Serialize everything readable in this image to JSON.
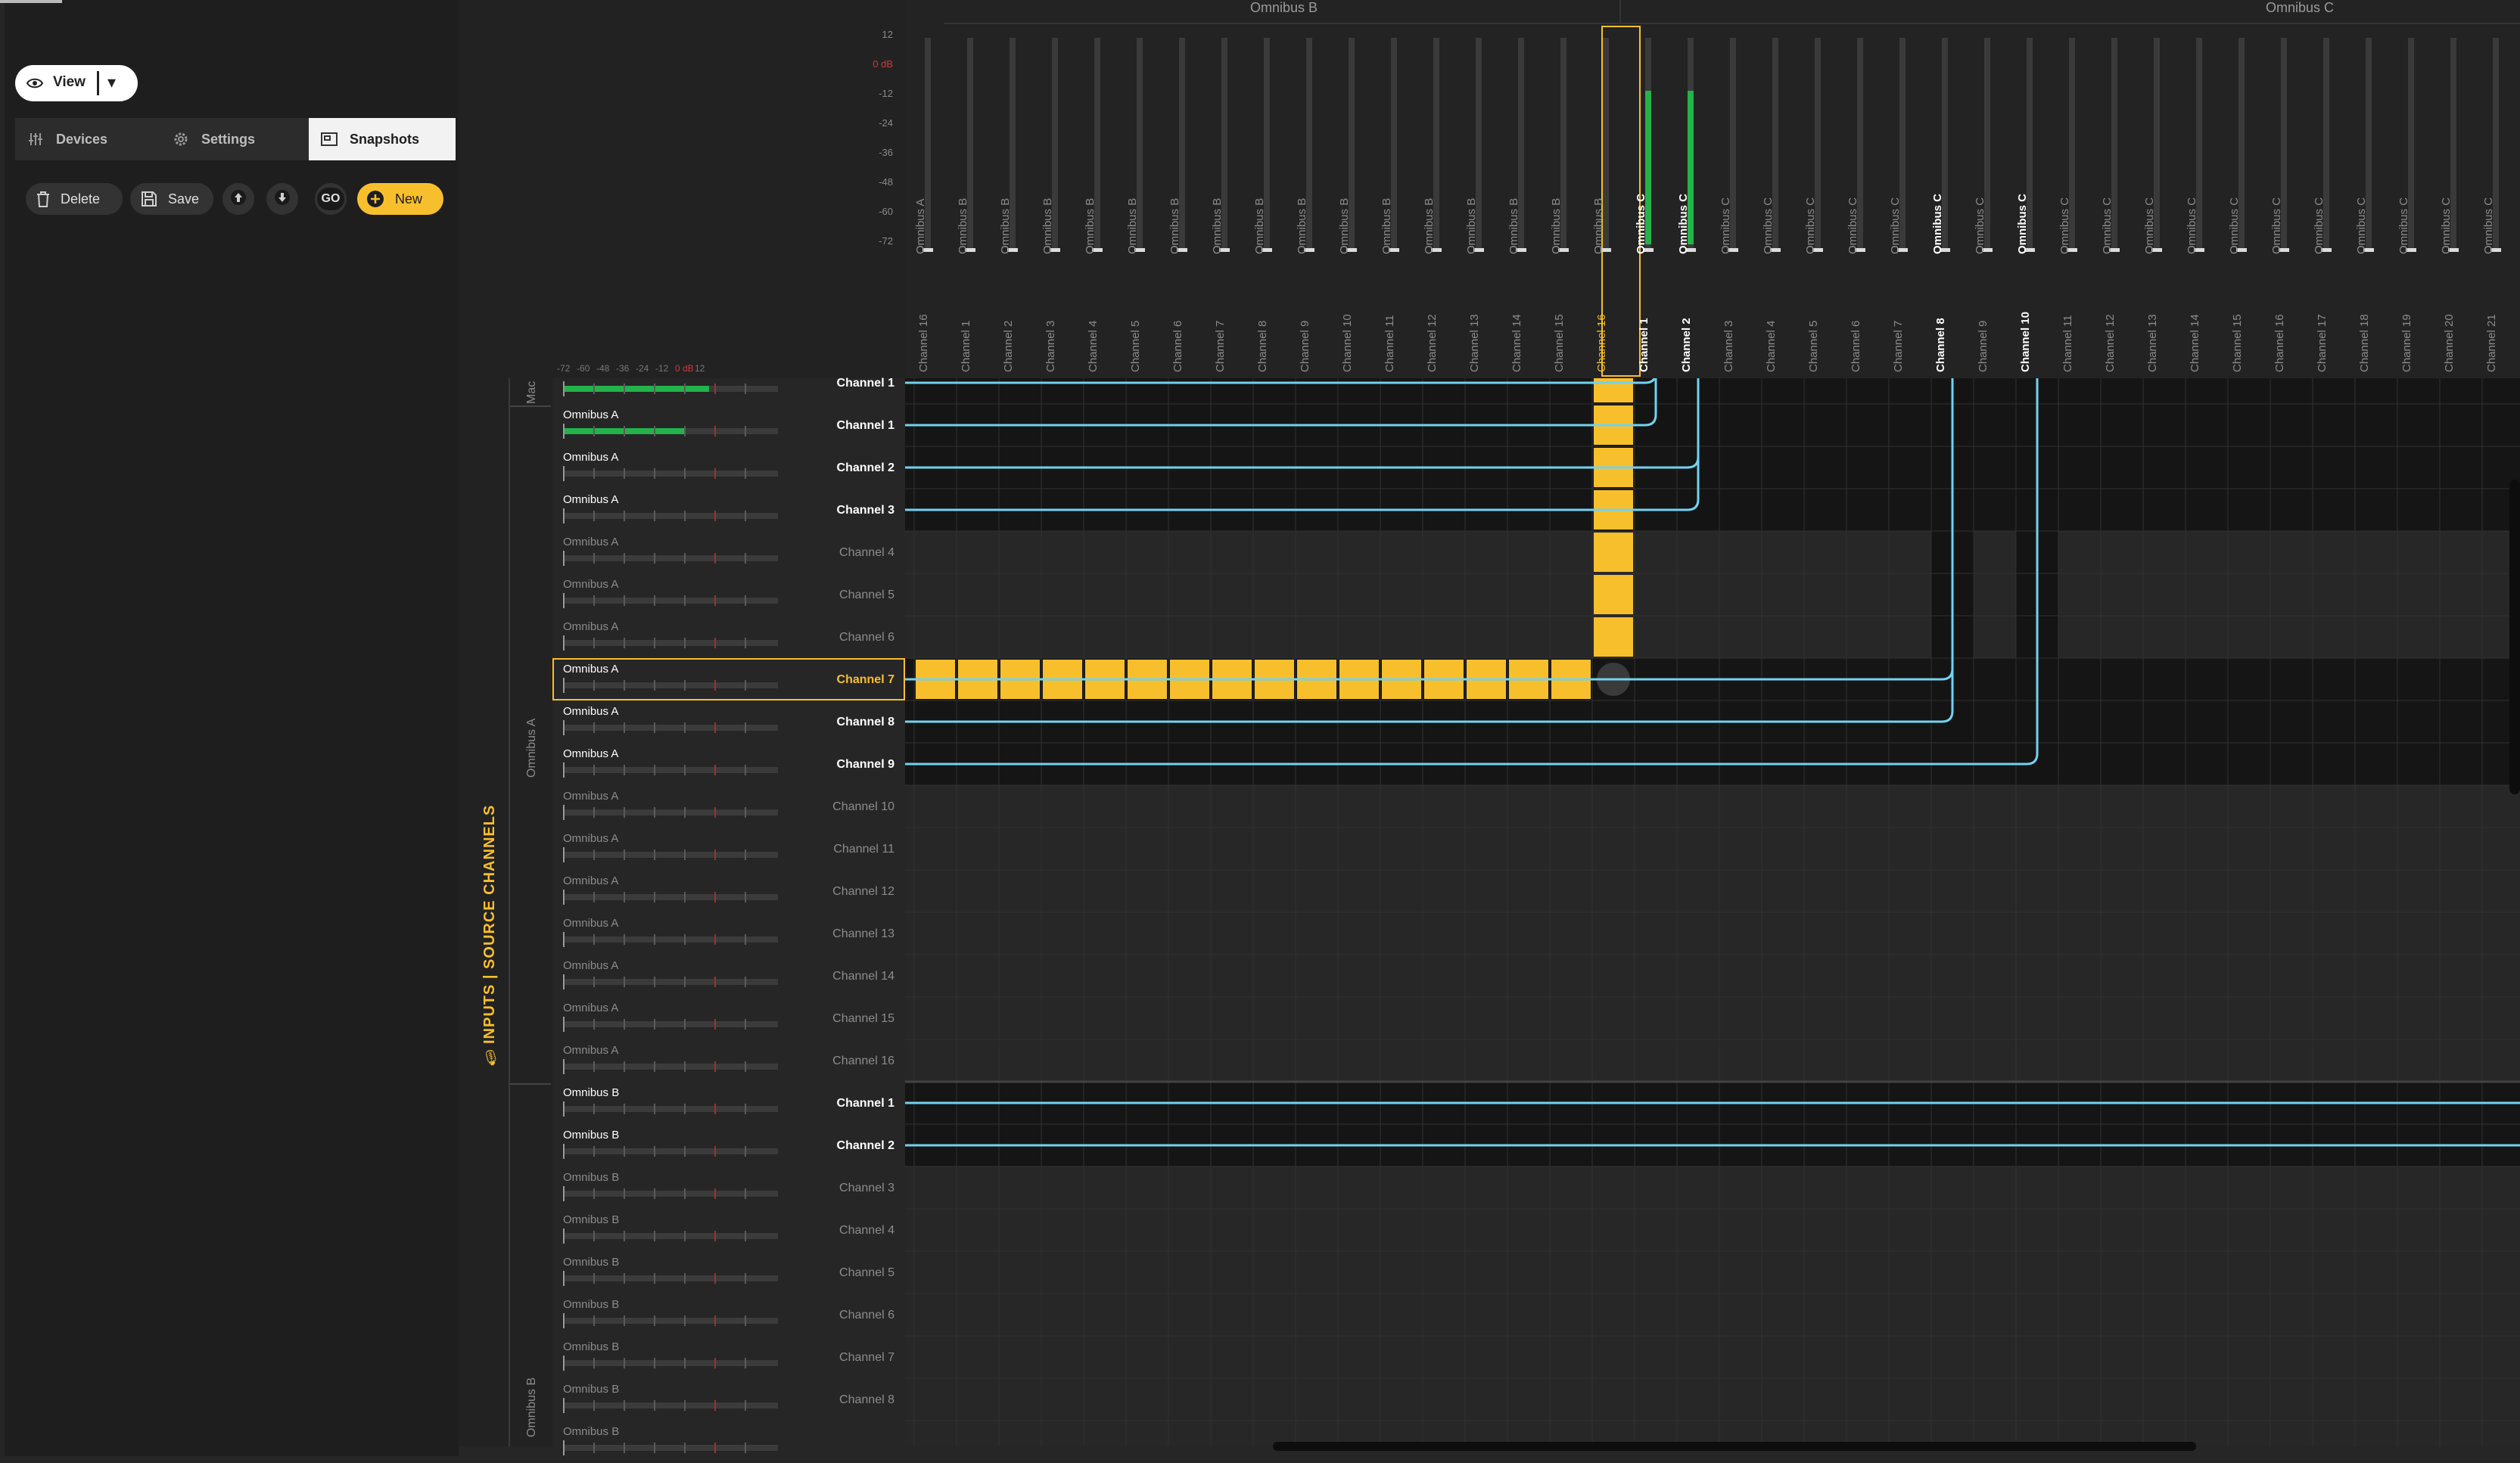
{
  "toolbar": {
    "view_label": "View"
  },
  "tabs": [
    {
      "label": "Devices",
      "icon": "sliders-icon"
    },
    {
      "label": "Settings",
      "icon": "gear-icon"
    },
    {
      "label": "Snapshots",
      "icon": "snapshot-icon",
      "active": true
    }
  ],
  "snapshots": {
    "delete_label": "Delete",
    "save_label": "Save",
    "go_label": "GO",
    "new_label": "New"
  },
  "outputs": {
    "bus_b_title": "Omnibus B",
    "bus_c_title": "Omnibus C",
    "scale_labels": [
      "12",
      "0 dB",
      "-12",
      "-24",
      "-36",
      "-48",
      "-60",
      "-72"
    ],
    "columns": [
      {
        "bus": "Omnibus A",
        "channel": "Channel 16"
      },
      {
        "bus": "Omnibus B",
        "channel": "Channel 1"
      },
      {
        "bus": "Omnibus B",
        "channel": "Channel 2"
      },
      {
        "bus": "Omnibus B",
        "channel": "Channel 3"
      },
      {
        "bus": "Omnibus B",
        "channel": "Channel 4"
      },
      {
        "bus": "Omnibus B",
        "channel": "Channel 5"
      },
      {
        "bus": "Omnibus B",
        "channel": "Channel 6"
      },
      {
        "bus": "Omnibus B",
        "channel": "Channel 7"
      },
      {
        "bus": "Omnibus B",
        "channel": "Channel 8"
      },
      {
        "bus": "Omnibus B",
        "channel": "Channel 9"
      },
      {
        "bus": "Omnibus B",
        "channel": "Channel 10"
      },
      {
        "bus": "Omnibus B",
        "channel": "Channel 11"
      },
      {
        "bus": "Omnibus B",
        "channel": "Channel 12"
      },
      {
        "bus": "Omnibus B",
        "channel": "Channel 13"
      },
      {
        "bus": "Omnibus B",
        "channel": "Channel 14"
      },
      {
        "bus": "Omnibus B",
        "channel": "Channel 15"
      },
      {
        "bus": "Omnibus B",
        "channel": "Channel 16",
        "selected": true
      },
      {
        "bus": "Omnibus C",
        "channel": "Channel 1",
        "bright": true,
        "level": 0.72
      },
      {
        "bus": "Omnibus C",
        "channel": "Channel 2",
        "bright": true,
        "level": 0.72
      },
      {
        "bus": "Omnibus C",
        "channel": "Channel 3"
      },
      {
        "bus": "Omnibus C",
        "channel": "Channel 4"
      },
      {
        "bus": "Omnibus C",
        "channel": "Channel 5"
      },
      {
        "bus": "Omnibus C",
        "channel": "Channel 6"
      },
      {
        "bus": "Omnibus C",
        "channel": "Channel 7"
      },
      {
        "bus": "Omnibus C",
        "channel": "Channel 8",
        "bright": true
      },
      {
        "bus": "Omnibus C",
        "channel": "Channel 9"
      },
      {
        "bus": "Omnibus C",
        "channel": "Channel 10",
        "bright": true
      },
      {
        "bus": "Omnibus C",
        "channel": "Channel 11"
      },
      {
        "bus": "Omnibus C",
        "channel": "Channel 12"
      },
      {
        "bus": "Omnibus C",
        "channel": "Channel 13"
      },
      {
        "bus": "Omnibus C",
        "channel": "Channel 14"
      },
      {
        "bus": "Omnibus C",
        "channel": "Channel 15"
      },
      {
        "bus": "Omnibus C",
        "channel": "Channel 16"
      },
      {
        "bus": "Omnibus C",
        "channel": "Channel 17"
      },
      {
        "bus": "Omnibus C",
        "channel": "Channel 18"
      },
      {
        "bus": "Omnibus C",
        "channel": "Channel 19"
      },
      {
        "bus": "Omnibus C",
        "channel": "Channel 20"
      },
      {
        "bus": "Omnibus C",
        "channel": "Channel 21"
      }
    ]
  },
  "inputs": {
    "title": "INPUTS | SOURCE CHANNELS",
    "scale_labels": [
      "-72",
      "-60",
      "-48",
      "-36",
      "-24",
      "-12",
      "0 dB",
      "12"
    ],
    "groups": [
      "Mac",
      "Omnibus A",
      "Omnibus B"
    ],
    "rows": [
      {
        "bus": "",
        "channel": "Channel 1",
        "bright": true,
        "level": 0.68
      },
      {
        "bus": "Omnibus A",
        "channel": "Channel 1",
        "bright": true,
        "level": 0.57
      },
      {
        "bus": "Omnibus A",
        "channel": "Channel 2",
        "bright": true
      },
      {
        "bus": "Omnibus A",
        "channel": "Channel 3",
        "bright": true
      },
      {
        "bus": "Omnibus A",
        "channel": "Channel 4"
      },
      {
        "bus": "Omnibus A",
        "channel": "Channel 5"
      },
      {
        "bus": "Omnibus A",
        "channel": "Channel 6"
      },
      {
        "bus": "Omnibus A",
        "channel": "Channel 7",
        "bright": true,
        "selected": true
      },
      {
        "bus": "Omnibus A",
        "channel": "Channel 8",
        "bright": true
      },
      {
        "bus": "Omnibus A",
        "channel": "Channel 9",
        "bright": true
      },
      {
        "bus": "Omnibus A",
        "channel": "Channel 10"
      },
      {
        "bus": "Omnibus A",
        "channel": "Channel 11"
      },
      {
        "bus": "Omnibus A",
        "channel": "Channel 12"
      },
      {
        "bus": "Omnibus A",
        "channel": "Channel 13"
      },
      {
        "bus": "Omnibus A",
        "channel": "Channel 14"
      },
      {
        "bus": "Omnibus A",
        "channel": "Channel 15"
      },
      {
        "bus": "Omnibus A",
        "channel": "Channel 16"
      },
      {
        "bus": "Omnibus B",
        "channel": "Channel 1",
        "bright": true
      },
      {
        "bus": "Omnibus B",
        "channel": "Channel 2",
        "bright": true
      },
      {
        "bus": "Omnibus B",
        "channel": "Channel 3"
      },
      {
        "bus": "Omnibus B",
        "channel": "Channel 4"
      },
      {
        "bus": "Omnibus B",
        "channel": "Channel 5"
      },
      {
        "bus": "Omnibus B",
        "channel": "Channel 6"
      },
      {
        "bus": "Omnibus B",
        "channel": "Channel 7"
      },
      {
        "bus": "Omnibus B",
        "channel": "Channel 8"
      },
      {
        "bus": "Omnibus B",
        "channel": ""
      }
    ]
  },
  "routes": [
    {
      "row": 0,
      "col": 17
    },
    {
      "row": 1,
      "col": 17
    },
    {
      "row": 2,
      "col": 18
    },
    {
      "row": 3,
      "col": 18
    },
    {
      "row": 7,
      "col": 24
    },
    {
      "row": 8,
      "col": 24
    },
    {
      "row": 9,
      "col": 26
    },
    {
      "row": 17,
      "col": null
    },
    {
      "row": 18,
      "col": null
    }
  ],
  "colors": {
    "accent": "#f8bf2d",
    "route": "#72d2f0",
    "meter": "#22b34a",
    "zero_db": "#d03a3a"
  }
}
